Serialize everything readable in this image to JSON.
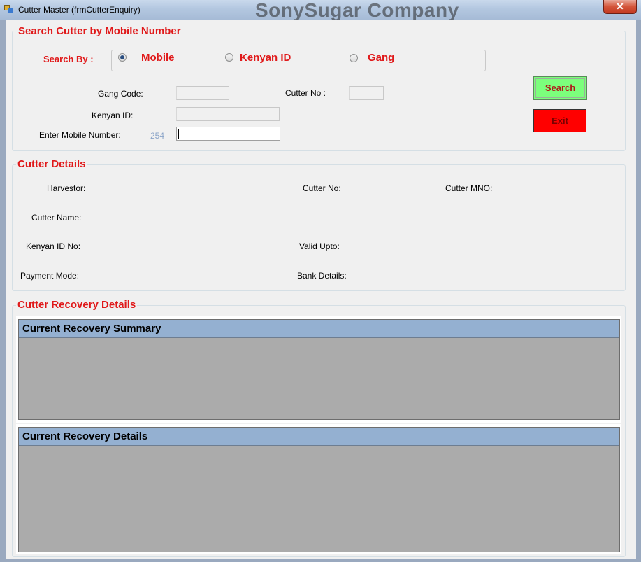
{
  "window": {
    "title": "Cutter Master (frmCutterEnquiry)",
    "watermark": "SonySugar Company",
    "close_label": "✕"
  },
  "search": {
    "group_title": "Search Cutter by Mobile Number",
    "search_by_label": "Search By :",
    "options": [
      {
        "label": "Mobile",
        "checked": true
      },
      {
        "label": "Kenyan ID",
        "checked": false
      },
      {
        "label": "Gang",
        "checked": false
      }
    ],
    "gang_code_label": "Gang Code:",
    "gang_code_value": "",
    "cutter_no_label": "Cutter No :",
    "cutter_no_value": "",
    "kenyan_id_label": "Kenyan ID:",
    "kenyan_id_value": "",
    "mobile_label": "Enter Mobile Number:",
    "mobile_prefix": "254",
    "mobile_value": "",
    "search_button": "Search",
    "exit_button": "Exit"
  },
  "details": {
    "group_title": "Cutter Details",
    "harvestor_label": "Harvestor:",
    "cutter_no_label": "Cutter No:",
    "cutter_mno_label": "Cutter MNO:",
    "cutter_name_label": "Cutter Name:",
    "kenyan_id_no_label": "Kenyan ID No:",
    "valid_upto_label": "Valid Upto:",
    "payment_mode_label": "Payment Mode:",
    "bank_details_label": "Bank Details:"
  },
  "recovery": {
    "group_title": "Cutter Recovery Details",
    "summary_title": "Current Recovery Summary",
    "details_title": "Current Recovery Details"
  },
  "colors": {
    "accent_red": "#e0191a",
    "search_button_bg": "#7cff7c",
    "exit_button_bg": "#ff0000",
    "panel_header": "#94b0d1",
    "panel_body": "#ababab"
  }
}
